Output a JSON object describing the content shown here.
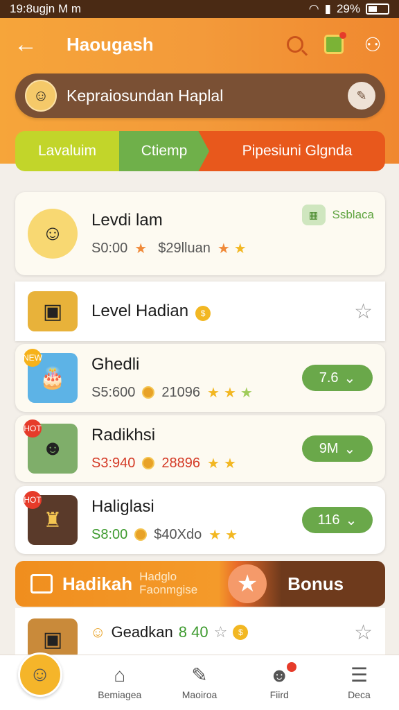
{
  "status": {
    "time": "19:8ugjn M m",
    "battery": "29%"
  },
  "topbar": {
    "title": "Haougash"
  },
  "search": {
    "placeholder": "Kepraiosundan Haplal"
  },
  "segments": [
    "Lavaluim",
    "Ctiemp",
    "Pipesiuni Glgnda"
  ],
  "items": [
    {
      "name": "Levdi lam",
      "price": "S0:00",
      "count": "$29lluan",
      "stars": "★★",
      "chip": "Ssblaca",
      "thumb_icon": "avatar-icon"
    },
    {
      "name": "Level Hadian",
      "thumb_icon": "game-icon"
    },
    {
      "name": "Ghedli",
      "price": "S5:600",
      "count": "21096",
      "stars": "★★★",
      "button": "7.6",
      "thumb_icon": "cake-icon",
      "badge": "NEW"
    },
    {
      "name": "Radikhsi",
      "price": "S3:940",
      "count": "28896",
      "stars": "★★",
      "button": "9M",
      "thumb_icon": "people-icon",
      "badge": "HOT"
    },
    {
      "name": "Haliglasi",
      "price": "S8:00",
      "count": "$40Xdo",
      "stars": "★★",
      "button": "116",
      "thumb_icon": "scene-icon",
      "badge": "HOT"
    }
  ],
  "bonus": {
    "title": "Hadikah",
    "subtitle": "Hadglo Faonmgise",
    "label": "Bonus"
  },
  "partial_item": {
    "name": "Geadkan",
    "value": "8 40"
  },
  "nav": {
    "n1": "Bemiagea",
    "n2": "Maoiroa",
    "n3": "Fiird",
    "n4": "Deca"
  },
  "colors": {
    "accent": "#f39a3a",
    "brown": "#7a5034",
    "green": "#6aa84a",
    "red": "#e8581c"
  }
}
